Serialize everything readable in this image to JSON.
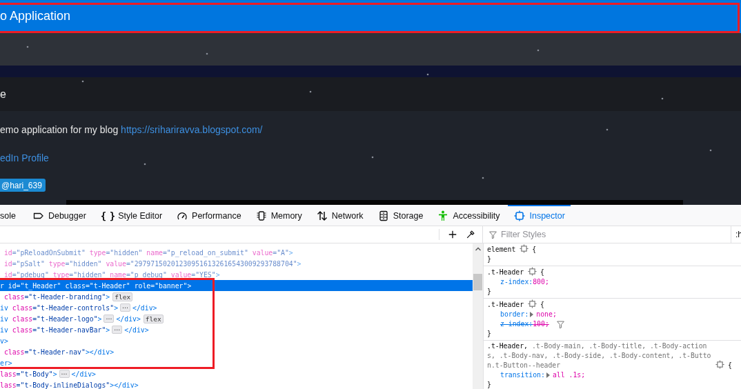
{
  "page": {
    "header_title": "o Application",
    "breadcrumb": "e",
    "intro": {
      "text": "emo application for my blog ",
      "link": "https://srihariravva.blogspot.com/"
    },
    "profile_link": "edIn Profile",
    "follow_button": "@hari_639"
  },
  "devtools": {
    "tabs": [
      {
        "label": "sole",
        "kind": "plain",
        "selected": false
      },
      {
        "label": "Debugger",
        "kind": "tag",
        "selected": false
      },
      {
        "label": "Style Editor",
        "kind": "braces",
        "icon_text": "{ }",
        "selected": false
      },
      {
        "label": "Performance",
        "kind": "gauge",
        "selected": false
      },
      {
        "label": "Memory",
        "kind": "chip",
        "selected": false
      },
      {
        "label": "Network",
        "kind": "arrows",
        "selected": false
      },
      {
        "label": "Storage",
        "kind": "storage",
        "selected": false
      },
      {
        "label": "Accessibility",
        "kind": "figure",
        "selected": false
      },
      {
        "label": "Inspector",
        "kind": "inspector",
        "selected": true
      }
    ],
    "filter": {
      "placeholder": "Filter Styles"
    },
    "pseudo_toggle": ":h",
    "markup_lines": [
      {
        "selected": false,
        "hidden": true,
        "parts": [
          {
            "kind": "attr",
            "text": " id"
          },
          {
            "kind": "value",
            "text": "=\"pReloadOnSubmit\""
          },
          {
            "kind": "attr",
            "text": " type"
          },
          {
            "kind": "value",
            "text": "=\"hidden\""
          },
          {
            "kind": "attr",
            "text": " name"
          },
          {
            "kind": "value",
            "text": "=\"p_reload_on_submit\""
          },
          {
            "kind": "attr",
            "text": " value"
          },
          {
            "kind": "value",
            "text": "=\"A\""
          },
          {
            "kind": "tag",
            "text": ">"
          }
        ]
      },
      {
        "selected": false,
        "hidden": true,
        "parts": [
          {
            "kind": "attr",
            "text": " id"
          },
          {
            "kind": "value",
            "text": "=\"pSalt\""
          },
          {
            "kind": "attr",
            "text": " type"
          },
          {
            "kind": "value",
            "text": "=\"hidden\""
          },
          {
            "kind": "attr",
            "text": " value"
          },
          {
            "kind": "value",
            "text": "=\"297971502012309516132616543009293788704\""
          },
          {
            "kind": "tag",
            "text": ">"
          }
        ]
      },
      {
        "selected": false,
        "hidden": true,
        "parts": [
          {
            "kind": "attr",
            "text": " id"
          },
          {
            "kind": "value",
            "text": "=\"pdebug\""
          },
          {
            "kind": "attr",
            "text": " type"
          },
          {
            "kind": "value",
            "text": "=\"hidden\""
          },
          {
            "kind": "attr",
            "text": " name"
          },
          {
            "kind": "value",
            "text": "=\"p_debug\""
          },
          {
            "kind": "attr",
            "text": " value"
          },
          {
            "kind": "value",
            "text": "=\"YES\""
          },
          {
            "kind": "tag",
            "text": ">"
          }
        ]
      },
      {
        "selected": true,
        "hidden": false,
        "parts": [
          {
            "kind": "tag",
            "text": "r"
          },
          {
            "kind": "attr",
            "text": " id"
          },
          {
            "kind": "value",
            "text": "=\"t_Header\""
          },
          {
            "kind": "attr",
            "text": " class"
          },
          {
            "kind": "value",
            "text": "=\"t-Header\""
          },
          {
            "kind": "attr",
            "text": " role"
          },
          {
            "kind": "value",
            "text": "=\"banner\""
          },
          {
            "kind": "tag",
            "text": ">"
          }
        ]
      },
      {
        "selected": false,
        "hidden": false,
        "parts": [
          {
            "kind": "attr",
            "text": " class"
          },
          {
            "kind": "value",
            "text": "=\"t-Header-branding\""
          },
          {
            "kind": "tag",
            "text": ">"
          },
          {
            "kind": "badge",
            "text": "flex"
          }
        ]
      },
      {
        "selected": false,
        "hidden": false,
        "parts": [
          {
            "kind": "tag",
            "text": "iv"
          },
          {
            "kind": "attr",
            "text": " class"
          },
          {
            "kind": "value",
            "text": "=\"t-Header-controls\""
          },
          {
            "kind": "tag",
            "text": ">"
          },
          {
            "kind": "more",
            "text": "⋯"
          },
          {
            "kind": "tag",
            "text": "</div>"
          }
        ]
      },
      {
        "selected": false,
        "hidden": false,
        "parts": [
          {
            "kind": "tag",
            "text": "iv"
          },
          {
            "kind": "attr",
            "text": " class"
          },
          {
            "kind": "value",
            "text": "=\"t-Header-logo\""
          },
          {
            "kind": "tag",
            "text": ">"
          },
          {
            "kind": "more",
            "text": "⋯"
          },
          {
            "kind": "tag",
            "text": "</div>"
          },
          {
            "kind": "badge",
            "text": "flex"
          }
        ]
      },
      {
        "selected": false,
        "hidden": false,
        "parts": [
          {
            "kind": "tag",
            "text": "iv"
          },
          {
            "kind": "attr",
            "text": " class"
          },
          {
            "kind": "value",
            "text": "=\"t-Header-navBar\""
          },
          {
            "kind": "tag",
            "text": ">"
          },
          {
            "kind": "more",
            "text": "⋯"
          },
          {
            "kind": "tag",
            "text": "</div>"
          }
        ]
      },
      {
        "selected": false,
        "hidden": false,
        "parts": [
          {
            "kind": "tag",
            "text": "v>"
          }
        ]
      },
      {
        "selected": false,
        "hidden": false,
        "parts": [
          {
            "kind": "attr",
            "text": " class"
          },
          {
            "kind": "value",
            "text": "=\"t-Header-nav\""
          },
          {
            "kind": "tag",
            "text": "></div>"
          }
        ]
      },
      {
        "selected": false,
        "hidden": false,
        "parts": [
          {
            "kind": "tag",
            "text": "er>"
          }
        ]
      },
      {
        "selected": false,
        "hidden": false,
        "parts": [
          {
            "kind": "attr",
            "text": "lass"
          },
          {
            "kind": "value",
            "text": "=\"t-Body\""
          },
          {
            "kind": "tag",
            "text": ">"
          },
          {
            "kind": "more",
            "text": "⋯"
          },
          {
            "kind": "tag",
            "text": "</div>"
          }
        ]
      },
      {
        "selected": false,
        "hidden": false,
        "parts": [
          {
            "kind": "attr",
            "text": "lass"
          },
          {
            "kind": "value",
            "text": "=\"t-Body-inlineDialogs\""
          },
          {
            "kind": "tag",
            "text": "></div>"
          }
        ]
      }
    ],
    "rules": [
      {
        "selectors": [
          {
            "text": "element",
            "matched": true
          }
        ],
        "open": "{",
        "close": "}"
      },
      {
        "selectors": [
          {
            "text": ".t-Header",
            "matched": true
          }
        ],
        "open": "{",
        "close": "}",
        "decls": [
          {
            "prop": "z-index:",
            "value": "800;",
            "expandable": false,
            "overridden": false
          }
        ]
      },
      {
        "selectors": [
          {
            "text": ".t-Header",
            "matched": true
          }
        ],
        "open": "{",
        "close": "}",
        "decls": [
          {
            "prop": "border:",
            "value": "none;",
            "expandable": true,
            "overridden": false
          },
          {
            "prop": "z-index:",
            "value": "100;",
            "expandable": false,
            "overridden": true
          }
        ]
      },
      {
        "selectors": [
          {
            "text": ".t-Header,",
            "matched": true
          },
          {
            "text": " .t-Body-main,",
            "matched": false
          },
          {
            "text": " .t-Body-title,",
            "matched": false
          },
          {
            "text": " .t-Body-actions,",
            "matched": false
          },
          {
            "text": " .t-Body-nav,",
            "matched": false
          },
          {
            "text": " .t-Body-side,",
            "matched": false
          },
          {
            "text": " .t-Body-content,",
            "matched": false
          },
          {
            "text": " .t-Button.t-Button--header",
            "matched": false
          }
        ],
        "open": "{",
        "close": "}",
        "decls": [
          {
            "prop": "transition:",
            "value": "all .1s;",
            "expandable": true,
            "overridden": false
          }
        ]
      }
    ]
  }
}
